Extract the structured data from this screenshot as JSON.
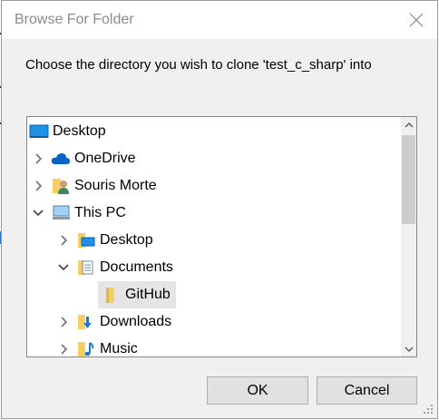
{
  "dialog": {
    "title": "Browse For Folder",
    "prompt": "Choose the directory you wish to clone 'test_c_sharp' into"
  },
  "tree": {
    "items": [
      {
        "label": "Desktop",
        "icon": "desktop-blue-icon",
        "expander": "none"
      },
      {
        "label": "OneDrive",
        "icon": "cloud-icon",
        "expander": "collapsed"
      },
      {
        "label": "Souris Morte",
        "icon": "user-folder-icon",
        "expander": "collapsed"
      },
      {
        "label": "This PC",
        "icon": "computer-icon",
        "expander": "expanded"
      },
      {
        "label": "Desktop",
        "icon": "desktop-folder-icon",
        "expander": "collapsed"
      },
      {
        "label": "Documents",
        "icon": "documents-folder-icon",
        "expander": "expanded"
      },
      {
        "label": "GitHub",
        "icon": "folder-icon",
        "expander": "none",
        "selected": true
      },
      {
        "label": "Downloads",
        "icon": "downloads-folder-icon",
        "expander": "collapsed"
      },
      {
        "label": "Music",
        "icon": "music-folder-icon",
        "expander": "collapsed"
      }
    ]
  },
  "buttons": {
    "ok": "OK",
    "cancel": "Cancel"
  },
  "colors": {
    "accent": "#0078d7",
    "folder": "#f5cf62",
    "selection": "#e5e5e5"
  }
}
